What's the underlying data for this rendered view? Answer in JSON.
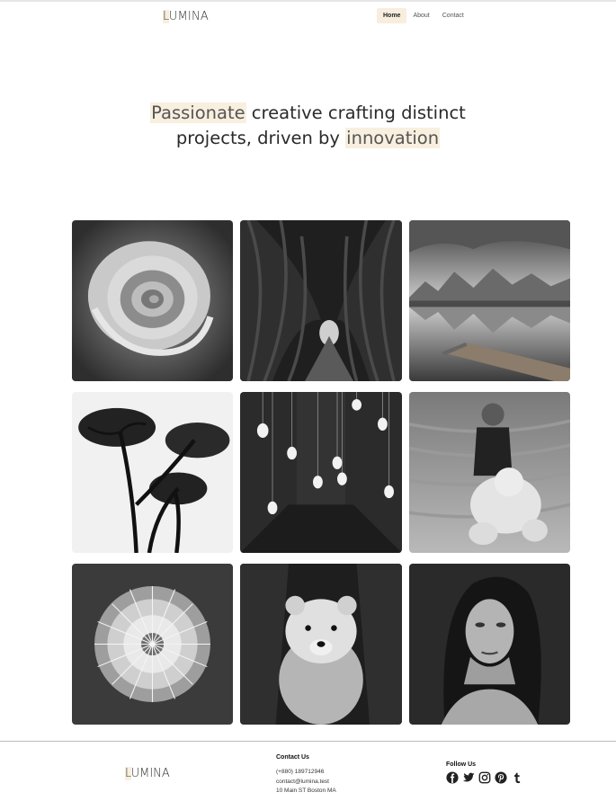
{
  "brand": {
    "logo_first": "L",
    "logo_rest": "UMINA"
  },
  "nav": {
    "items": [
      "Home",
      "About",
      "Contact"
    ],
    "active": "Home"
  },
  "hero": {
    "highlight1": "Passionate",
    "text1": " creative crafting distinct",
    "text2": "projects, driven by ",
    "highlight2": "innovation"
  },
  "gallery": {
    "items": [
      "rose",
      "forest-path",
      "mountain-lake",
      "trees-silhouette",
      "hanging-bulbs",
      "girl-with-teddy",
      "dandelion",
      "polar-bear-cub",
      "woman-portrait"
    ]
  },
  "footer": {
    "contact_heading": "Contact Us",
    "phone": "(+880) 189712946",
    "email": "contact@lumina.test",
    "address": "10 Main ST Boston MA",
    "follow_heading": "Follow Us",
    "social_icons": [
      "facebook-icon",
      "twitter-icon",
      "instagram-icon",
      "pinterest-icon",
      "tumblr-icon"
    ]
  },
  "colors": {
    "accent_highlight": "#f7eedd",
    "footer_border": "#bdbdbd"
  }
}
